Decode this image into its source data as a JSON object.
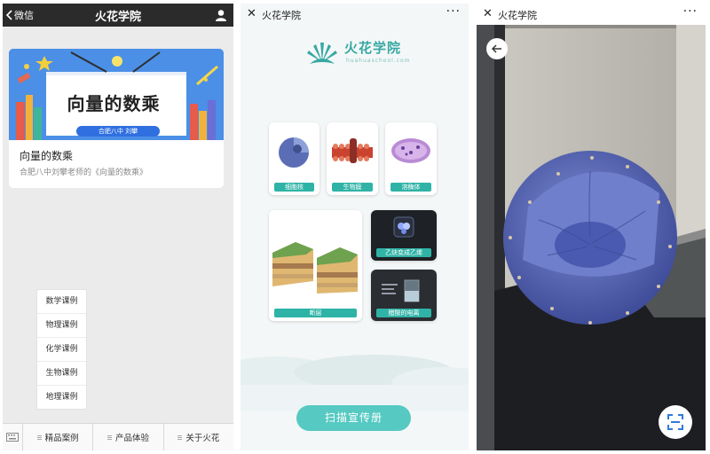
{
  "screen1": {
    "nav": {
      "back_label": "微信",
      "title": "火花学院"
    },
    "card": {
      "cover_title": "向量的数乘",
      "cover_tag": "合肥八中 刘攀",
      "title": "向量的数乘",
      "subtitle": "合肥八中刘攀老师的《向量的数乘》"
    },
    "popup_menu": [
      "数学课例",
      "物理课例",
      "化学课例",
      "生物课例",
      "地理课例"
    ],
    "tabs": [
      "精品案例",
      "产品体验",
      "关于火花"
    ]
  },
  "screen2": {
    "nav": {
      "close_icon": "close-icon",
      "title": "火花学院",
      "more_label": "···"
    },
    "logo": {
      "name": "火花学院",
      "sub": "huahuaschool.com",
      "color": "#36a8a3"
    },
    "tiles": [
      "细胞核",
      "生物膜",
      "溶酶体",
      "断层",
      "乙炔变成乙烯",
      "醋酸的电离"
    ],
    "scan_button": "扫描宣传册",
    "accent": "#2fb3a6"
  },
  "screen3": {
    "nav": {
      "title": "火花学院",
      "more_label": "···"
    },
    "model_color": "#5f6fb8",
    "icons": [
      "back-arrow-icon",
      "scan-frame-icon"
    ]
  }
}
